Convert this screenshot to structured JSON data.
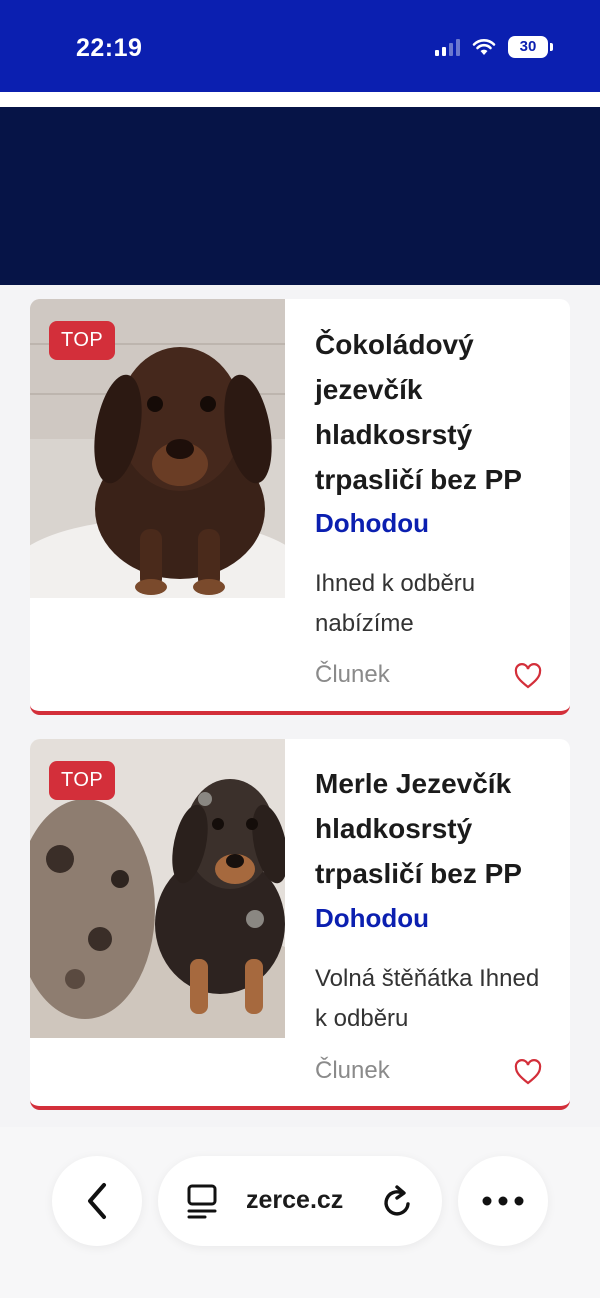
{
  "status": {
    "time": "22:19",
    "battery": "30"
  },
  "listings": [
    {
      "badge": "TOP",
      "title": "Čokoládový jezevčík hladkosrstý trpasličí bez PP",
      "price": "Dohodou",
      "desc": "Ihned k odběru nabízíme",
      "location": "Člunek"
    },
    {
      "badge": "TOP",
      "title": "Merle Jezevčík hladkosrstý trpasličí bez PP",
      "price": "Dohodou",
      "desc": "Volná štěňátka Ihned k odběru",
      "location": "Člunek"
    }
  ],
  "browser": {
    "url": "zerce.cz"
  },
  "colors": {
    "status_bg": "#0b1fb0",
    "banner_bg": "#061447",
    "accent_red": "#d32f3a",
    "price_blue": "#0b1fb0"
  }
}
